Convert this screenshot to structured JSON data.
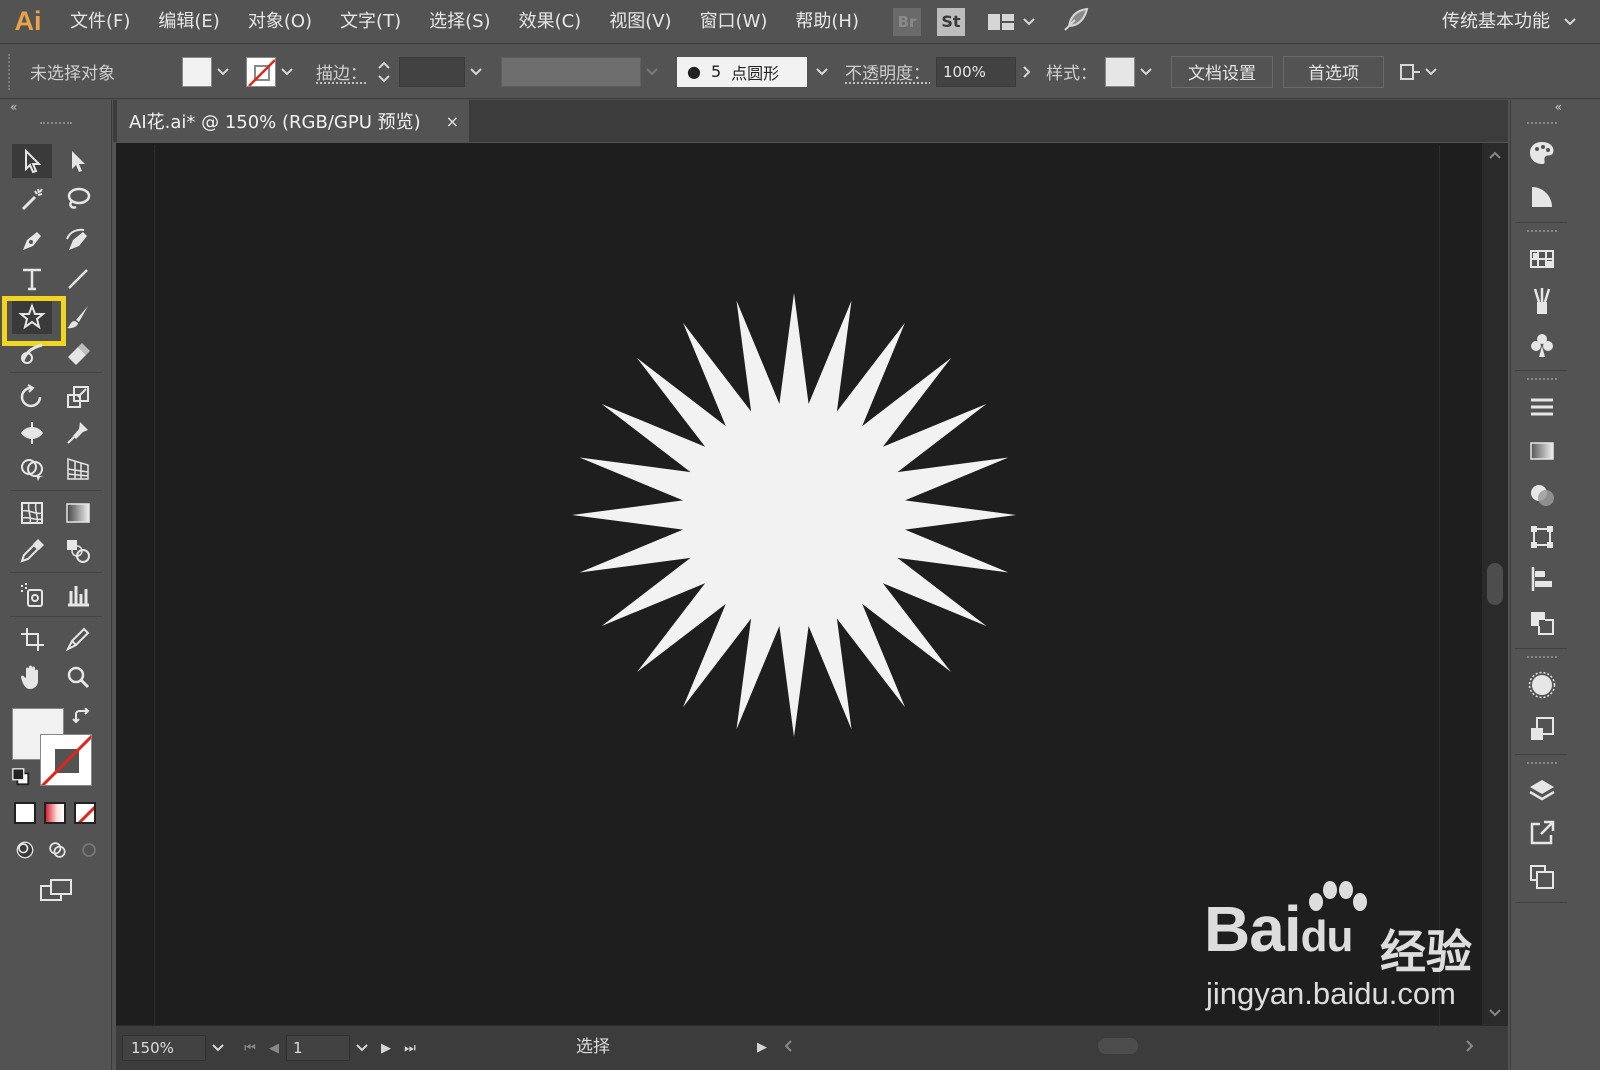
{
  "menubar": {
    "app_logo": "Ai",
    "items": [
      "文件(F)",
      "编辑(E)",
      "对象(O)",
      "文字(T)",
      "选择(S)",
      "效果(C)",
      "视图(V)",
      "窗口(W)",
      "帮助(H)"
    ],
    "bridge_label": "Br",
    "stock_label": "St",
    "workspace": "传统基本功能"
  },
  "controlbar": {
    "selection_status": "未选择对象",
    "stroke_label": "描边：",
    "brush_size": "5",
    "brush_label": "点圆形",
    "opacity_label": "不透明度：",
    "opacity_value": "100%",
    "style_label": "样式：",
    "doc_setup_button": "文档设置",
    "preferences_button": "首选项"
  },
  "document": {
    "tab_title": "AI花.ai* @ 150% (RGB/GPU 预览)",
    "close_glyph": "×"
  },
  "statusbar": {
    "zoom": "150%",
    "page": "1",
    "status_text": "选择"
  },
  "artwork": {
    "shape": "starburst",
    "points": 24,
    "fill_color": "#f2f2f2"
  },
  "colors": {
    "ui_bg": "#535353",
    "canvas_bg": "#1e1e1e",
    "highlight": "#f2d51f",
    "logo": "#e8a34b"
  },
  "tools": {
    "selected": "star-tool-icon"
  },
  "watermark": {
    "brand": "Bai",
    "brand_paw": "du",
    "cn": "经验",
    "url": "jingyan.baidu.com"
  }
}
